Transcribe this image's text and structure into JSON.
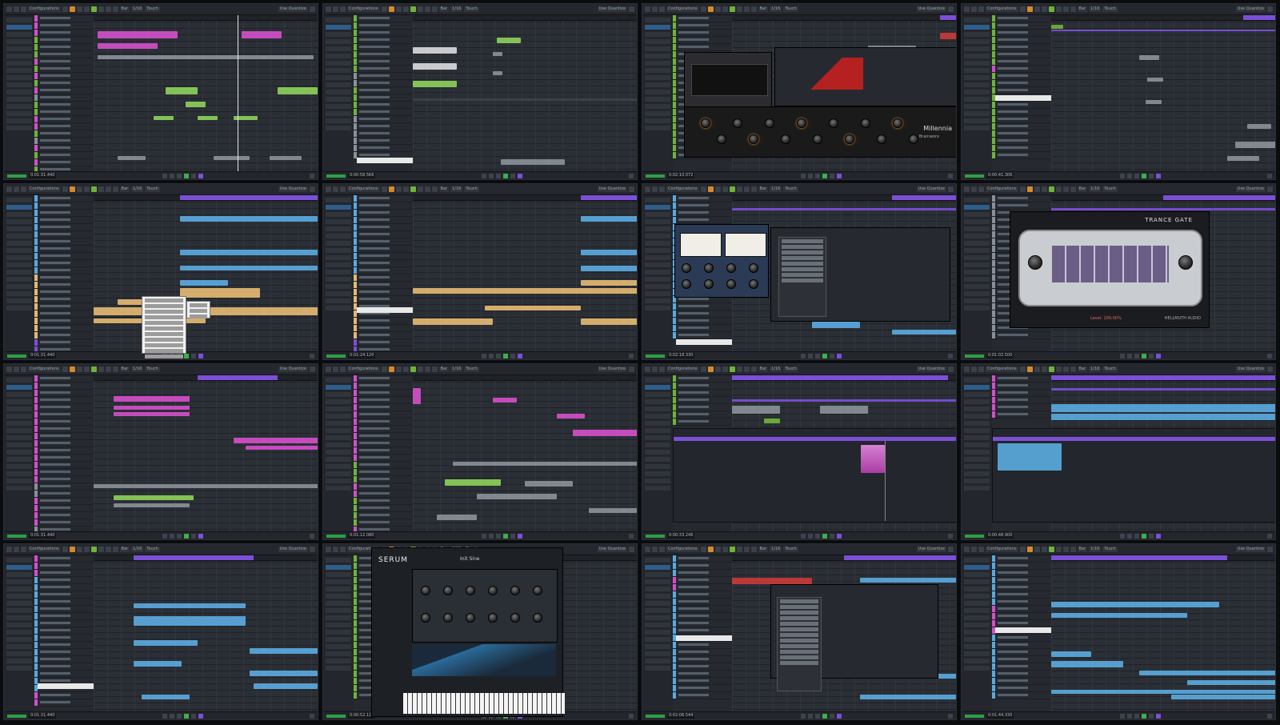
{
  "layout": "contact-sheet",
  "colors": {
    "background": "#0b0c0e",
    "panel": "#1c1f24",
    "loop_region": "#7b4fd6",
    "play": "#3fae4a",
    "clip_pink": "#d24fc9",
    "clip_green": "#8ccf5a",
    "clip_blue": "#5aa9dd",
    "clip_tan": "#e3b872",
    "clip_grey": "#8a9098"
  },
  "toolbar": {
    "configurations_label": "Configurations",
    "grid_label": "Bar",
    "quantize_label": "1/16",
    "touch_label": "Touch",
    "snap_label": "Use Quantize"
  },
  "transport_times": [
    "0:01:31.440",
    "0:00:58.566",
    "0:02:10.072",
    "0:00:41.306",
    "0:01:31.440",
    "0:01:24.120",
    "0:02:18.330",
    "0:01:02.500",
    "0:01:31.440",
    "0:01:12.080",
    "0:00:33.246",
    "0:00:48.900",
    "0:01:31.440",
    "0:00:52.118",
    "0:02:06.544",
    "0:01:44.330"
  ],
  "plugins": {
    "p3_brand": "Millennia",
    "p3_label": "Brainworx",
    "p8_title": "TRANCE GATE",
    "p8_vendor": "HELLMUTH AUDIO",
    "p8_level": "Level: 100.00%",
    "p14_title": "SERUM",
    "p14_preset": "Init Sine"
  },
  "icons": [
    "play-icon",
    "stop-icon",
    "record-icon",
    "cycle-icon",
    "rewind-icon",
    "forward-icon",
    "mute-icon",
    "solo-icon"
  ]
}
